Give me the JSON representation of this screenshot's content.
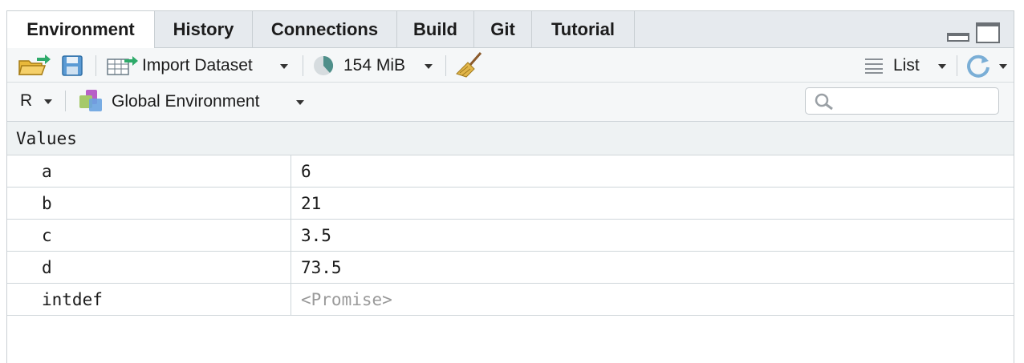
{
  "tabs": [
    {
      "label": "Environment",
      "active": true
    },
    {
      "label": "History"
    },
    {
      "label": "Connections"
    },
    {
      "label": "Build"
    },
    {
      "label": "Git"
    },
    {
      "label": "Tutorial"
    }
  ],
  "toolbar": {
    "import_dataset_label": "Import Dataset",
    "memory_label": "154 MiB",
    "view_label": "List"
  },
  "env_bar": {
    "language_label": "R",
    "environment_label": "Global Environment",
    "search_placeholder": ""
  },
  "values_section": {
    "header": "Values",
    "rows": [
      {
        "name": "a",
        "value": "6"
      },
      {
        "name": "b",
        "value": "21"
      },
      {
        "name": "c",
        "value": "3.5"
      },
      {
        "name": "d",
        "value": "73.5"
      },
      {
        "name": "intdef",
        "value": "<Promise>"
      }
    ]
  },
  "icons": {
    "open": "open-folder-icon",
    "save": "save-icon",
    "import": "import-dataset-icon",
    "memory": "memory-pie-icon",
    "clear": "broom-icon",
    "list": "list-icon",
    "refresh": "refresh-icon",
    "env": "environment-icon",
    "search": "search-icon"
  },
  "colors": {
    "accent_blue": "#4a90c8",
    "tab_bg": "#e6eaee",
    "promise_text": "#9a9a9a"
  }
}
